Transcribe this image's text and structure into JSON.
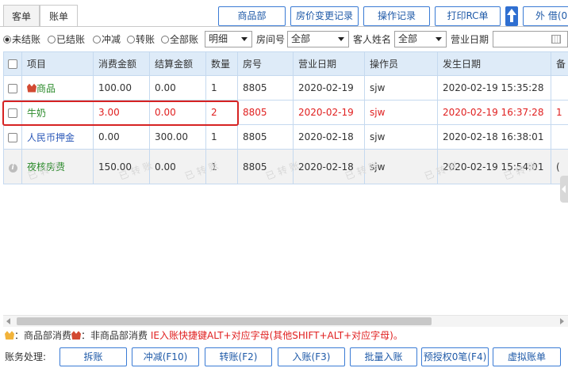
{
  "tabs": [
    {
      "label": "客单"
    },
    {
      "label": "账单"
    }
  ],
  "top_buttons": {
    "products": "商品部",
    "rate_change_log": "房价变更记录",
    "operation_log": "操作记录",
    "print_rc": "打印RC单",
    "external_borrow": "外 借(0"
  },
  "filter": {
    "radios": [
      "未结账",
      "已结账",
      "冲减",
      "转账",
      "全部账"
    ],
    "selected_radio": "未结账",
    "detail_select": "明细",
    "room_label": "房间号",
    "room_select": "全部",
    "guest_label": "客人姓名",
    "guest_select": "全部",
    "business_date_label": "营业日期"
  },
  "table": {
    "columns": [
      "项目",
      "消费金额",
      "结算金额",
      "数量",
      "房号",
      "营业日期",
      "操作员",
      "发生日期",
      "备"
    ],
    "rows": [
      {
        "item": "商品",
        "consumption": "100.00",
        "settlement": "0.00",
        "qty": "1",
        "room": "8805",
        "business_date": "2020-02-19",
        "operator": "sjw",
        "occurred": "2020-02-19 15:35:28",
        "extra": ""
      },
      {
        "item": "牛奶",
        "consumption": "3.00",
        "settlement": "0.00",
        "qty": "2",
        "room": "8805",
        "business_date": "2020-02-19",
        "operator": "sjw",
        "occurred": "2020-02-19 16:37:28",
        "extra": "1"
      },
      {
        "item": "人民币押金",
        "consumption": "0.00",
        "settlement": "300.00",
        "qty": "1",
        "room": "8805",
        "business_date": "2020-02-18",
        "operator": "sjw",
        "occurred": "2020-02-18 16:38:01",
        "extra": ""
      },
      {
        "item": "夜核房费",
        "consumption": "150.00",
        "settlement": "0.00",
        "qty": "1",
        "room": "8805",
        "business_date": "2020-02-18",
        "operator": "sjw",
        "occurred": "2020-02-19 15:54:01",
        "extra": "("
      }
    ],
    "watermark": "已 转 账"
  },
  "legend": {
    "product_consumption": "：商品部消费",
    "non_product_consumption": "：非商品部消费",
    "hint": "IE入账快捷键ALT+对应字母(其他SHIFT+ALT+对应字母)。"
  },
  "bottom": {
    "label": "账务处理:",
    "buttons": [
      "拆账",
      "冲减(F10)",
      "转账(F2)",
      "入账(F3)",
      "批量入账",
      "预授权0笔(F4)",
      "虚拟账单"
    ]
  },
  "colors": {
    "header_bg": "#deebf8",
    "accent": "#3a7bd5",
    "highlight_red": "#d62222",
    "green_text": "#2a8a2a",
    "blue_text": "#2b58b8"
  }
}
